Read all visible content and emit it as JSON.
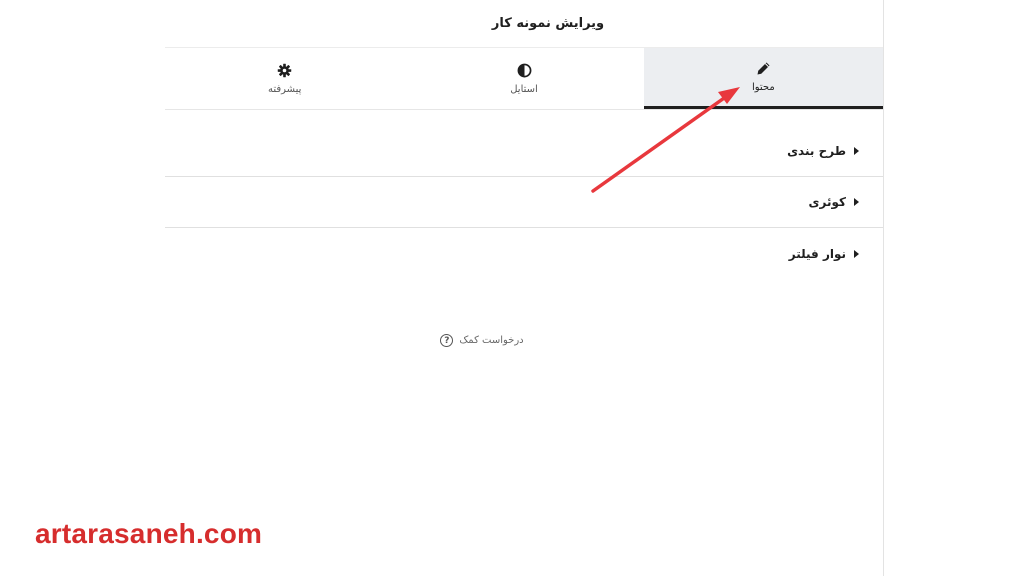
{
  "panel": {
    "title": "ویرایش نمونه کار"
  },
  "tabs": [
    {
      "label": "محتوا",
      "icon": "pencil-icon",
      "active": true
    },
    {
      "label": "استایل",
      "icon": "contrast-icon",
      "active": false
    },
    {
      "label": "پیشرفته",
      "icon": "gear-icon",
      "active": false
    }
  ],
  "sections": [
    {
      "label": "طرح بندی"
    },
    {
      "label": "کوئری"
    },
    {
      "label": "نوار فیلتر"
    }
  ],
  "help": {
    "label": "درخواست کمک",
    "icon": "question-icon"
  },
  "watermark": {
    "text": "artarasaneh.com",
    "color": "#d62d2d"
  },
  "colors": {
    "accent": "#1f1f1f",
    "active_tab_bg": "#eceef1",
    "annotation_arrow": "#e8383d"
  }
}
